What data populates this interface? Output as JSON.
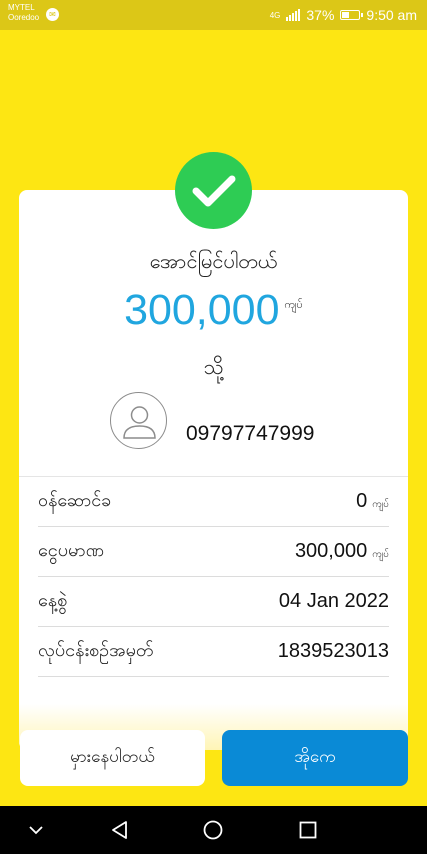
{
  "status_bar": {
    "carrier_line1": "MYTEL",
    "carrier_line2": "Ooredoo",
    "message_icon": "messenger-icon",
    "network_label": "4G",
    "battery_percent": "37%",
    "time": "9:50 am"
  },
  "receipt": {
    "success_icon": "check-icon",
    "title": "အောင်မြင်ပါတယ်",
    "amount": "300,000",
    "amount_unit": "ကျပ်",
    "to_label": "သို့",
    "recipient_avatar_icon": "user-avatar-icon",
    "recipient_phone": "09797747999",
    "details": [
      {
        "label": "ဝန်ဆောင်ခ",
        "value": "0",
        "unit": "ကျပ်"
      },
      {
        "label": "ငွေပမာဏ",
        "value": "300,000",
        "unit": "ကျပ်"
      },
      {
        "label": "နေ့စွဲ",
        "value": "04 Jan 2022",
        "unit": ""
      },
      {
        "label": "လုပ်ငန်းစဉ်အမှတ်",
        "value": "1839523013",
        "unit": ""
      }
    ]
  },
  "actions": {
    "report_button": "မှားနေပါတယ်",
    "ok_button": "အိုကေ"
  },
  "nav_bar": {
    "icons": [
      "chevron-down-icon",
      "back-icon",
      "home-icon",
      "recents-icon"
    ]
  },
  "colors": {
    "background": "#fde613",
    "status_bar": "#dcc717",
    "amount": "#20a6df",
    "success": "#2ecc54",
    "primary_button": "#0a8ad6"
  }
}
